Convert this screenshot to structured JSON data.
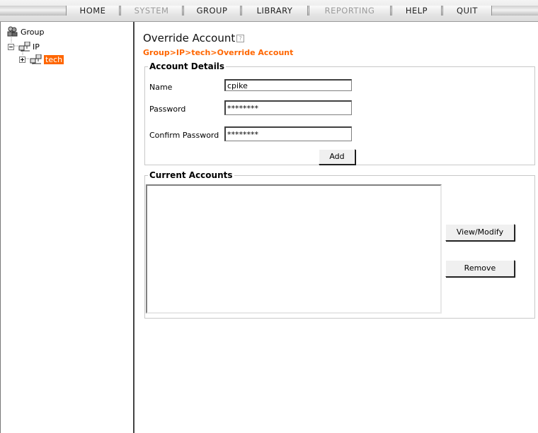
{
  "menu": {
    "home": "HOME",
    "system": "SYSTEM",
    "group": "GROUP",
    "library": "LIBRARY",
    "reporting": "REPORTING",
    "help": "HELP",
    "quit": "QUIT"
  },
  "tree": {
    "root": "Group",
    "ip": "IP",
    "tech": "tech"
  },
  "page": {
    "title": "Override Account",
    "help": "?",
    "breadcrumb": "Group>IP>tech>Override Account"
  },
  "account_details": {
    "legend": "Account Details",
    "name_label": "Name",
    "name_value": "cpike",
    "password_label": "Password",
    "password_value": "********",
    "confirm_label": "Confirm Password",
    "confirm_value": "********",
    "add_label": "Add"
  },
  "current_accounts": {
    "legend": "Current Accounts",
    "items": [],
    "view_modify_label": "View/Modify",
    "remove_label": "Remove"
  },
  "colors": {
    "accent": "#ff6600",
    "selection": "#ff6600"
  }
}
